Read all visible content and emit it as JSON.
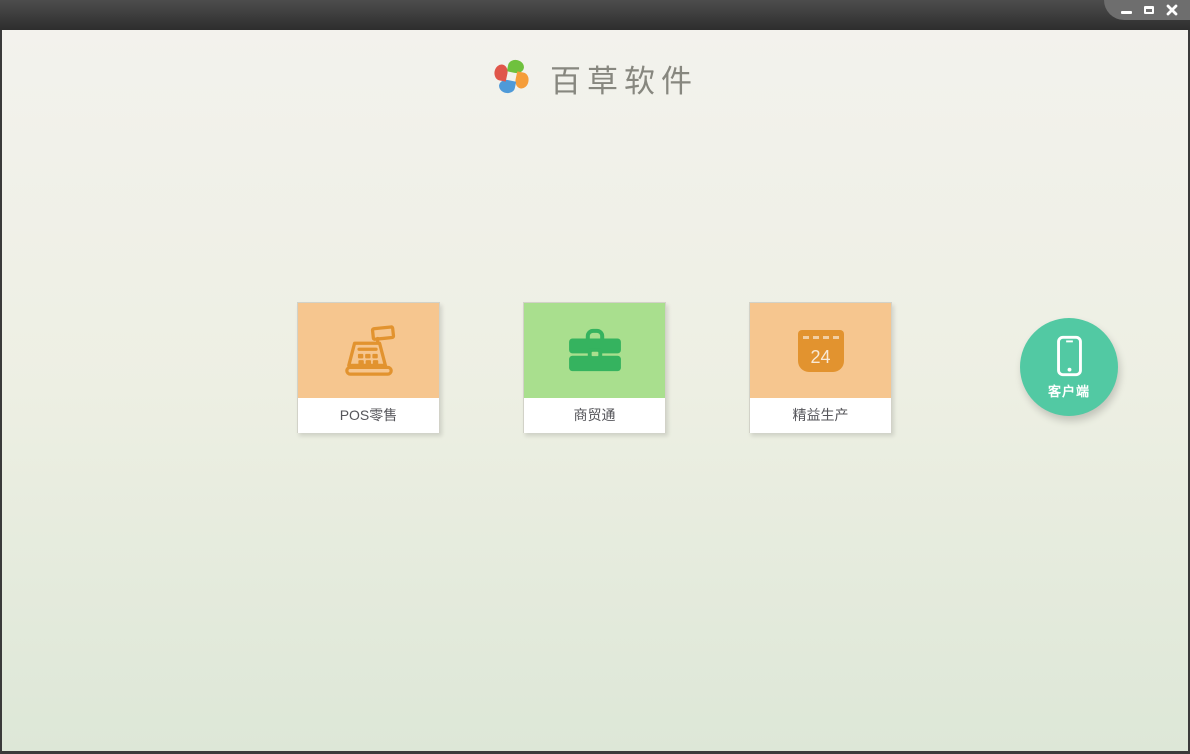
{
  "window": {
    "controls": {
      "minimize_icon": "minimize-bar",
      "maximize_icon": "maximize-box",
      "close_icon": "close-x"
    }
  },
  "header": {
    "logo_icon": "pinwheel-icon",
    "app_name": "百草软件"
  },
  "products": [
    {
      "label": "POS零售",
      "icon": "cash-register-icon",
      "tile_color": "#f6c68f",
      "icon_color": "#e2932f"
    },
    {
      "label": "商贸通",
      "icon": "briefcase-icon",
      "tile_color": "#a9df8e",
      "icon_color": "#35b35f"
    },
    {
      "label": "精益生产",
      "icon": "calendar-icon",
      "calendar_day": "24",
      "tile_color": "#f6c68f",
      "icon_color": "#e2932f"
    }
  ],
  "client_button": {
    "label": "客户端",
    "icon": "smartphone-icon",
    "color": "#52c9a3"
  },
  "colors": {
    "titlebar": "#3a3a3a",
    "titlebar_controls_bg": "#6e6e6e",
    "background_top": "#f3f2ed",
    "background_bottom": "#dde7d7",
    "card_label_text": "#55555a",
    "logo_green": "#6fc13e",
    "logo_orange": "#f59d3a",
    "logo_blue": "#4f9ad8",
    "logo_red": "#e0564a"
  }
}
